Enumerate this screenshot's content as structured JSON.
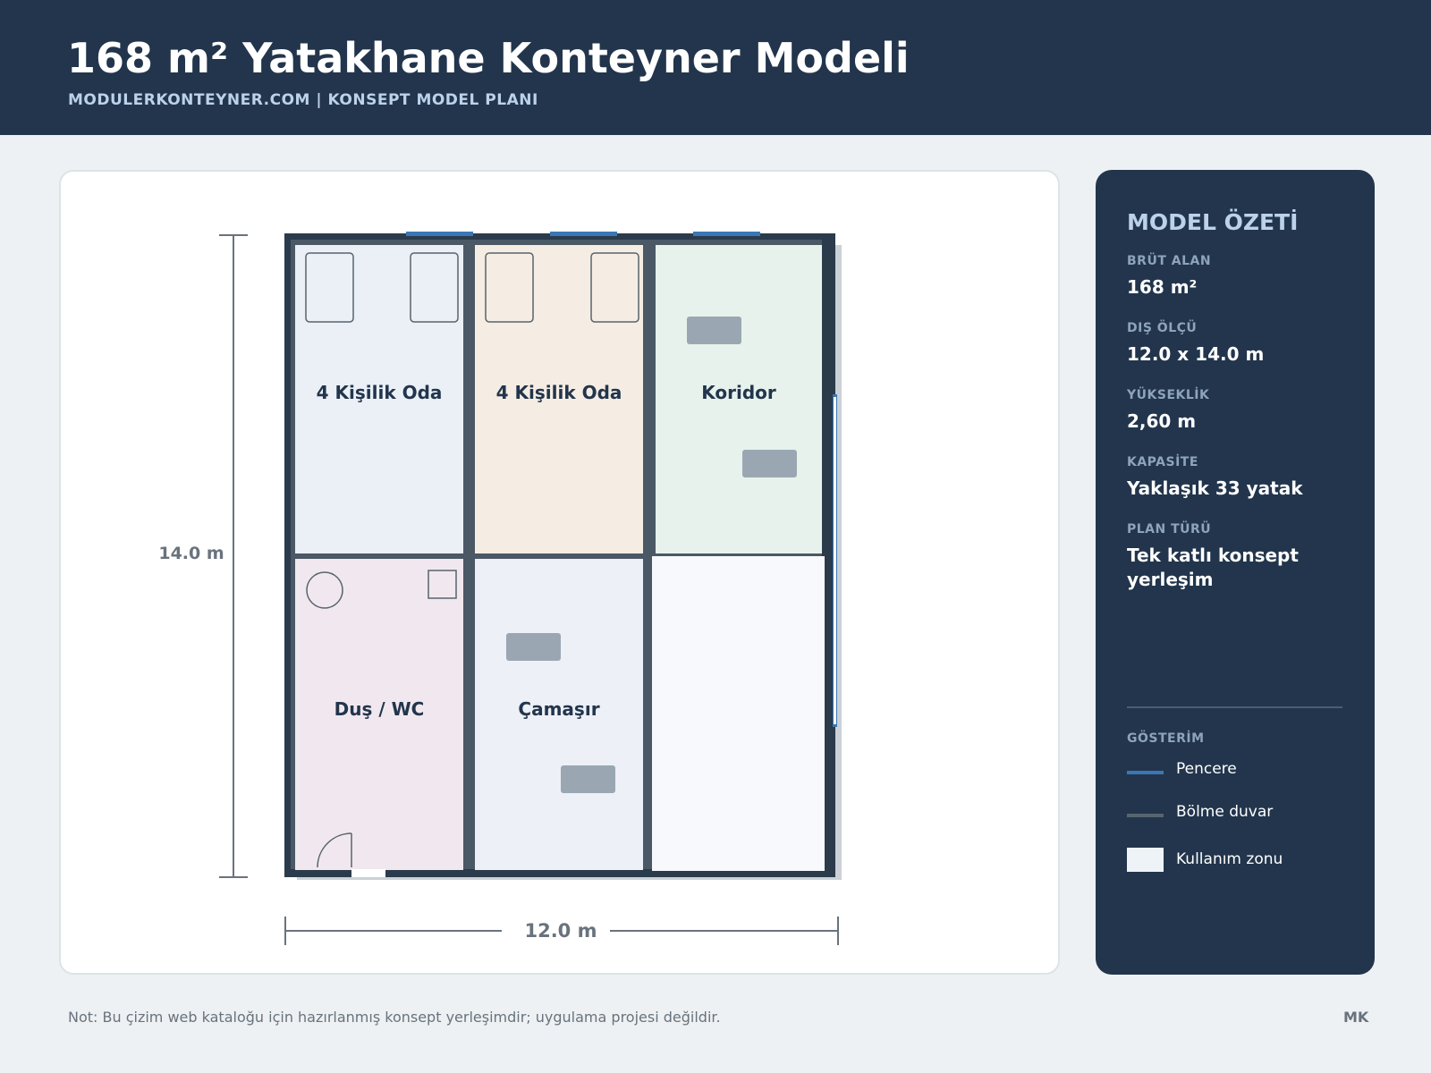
{
  "header": {
    "title": "168 m² Yatakhane Konteyner Modeli",
    "subtitle": "MODULERKONTEYNER.COM  |  KONSEPT MODEL PLANI"
  },
  "plan": {
    "rooms": [
      {
        "label": "4 Kişilik Oda",
        "fill": "#ebf0f7"
      },
      {
        "label": "4 Kişilik Oda",
        "fill": "#f5ede3"
      },
      {
        "label": "Koridor",
        "fill": "#e7f2ec"
      },
      {
        "label": "Duş / WC",
        "fill": "#f1e8ef"
      },
      {
        "label": "Çamaşır",
        "fill": "#edf0f6"
      },
      {
        "label": "",
        "fill": "#f7f9fc"
      }
    ],
    "dim_height": "14.0 m",
    "dim_width": "12.0 m"
  },
  "summary": {
    "title": "MODEL ÖZETİ",
    "fields": [
      {
        "label": "BRÜT ALAN",
        "value": "168 m²"
      },
      {
        "label": "DIŞ ÖLÇÜ",
        "value": "12.0 x 14.0 m"
      },
      {
        "label": "YÜKSEKLİK",
        "value": "2,60 m"
      },
      {
        "label": "KAPASİTE",
        "value": "Yaklaşık 33 yatak"
      },
      {
        "label": "PLAN TÜRÜ",
        "value": "Tek katlı konsept yerleşim"
      }
    ],
    "legend_title": "GÖSTERİM",
    "legend": [
      {
        "label": "Pencere",
        "color": "#3a77b5"
      },
      {
        "label": "Bölme duvar",
        "color": "#586470"
      },
      {
        "label": "Kullanım zonu",
        "color": "#eef3f8"
      }
    ]
  },
  "footer": {
    "note": "Not: Bu çizim web kataloğu için hazırlanmış konsept yerleşimdir; uygulama projesi değildir.",
    "mark": "MK"
  },
  "colors": {
    "header_bg": "#22354c",
    "wall": "#2b3b4c",
    "partition": "#586470",
    "window": "#3a77b5",
    "furniture": "#9aa7b3"
  }
}
